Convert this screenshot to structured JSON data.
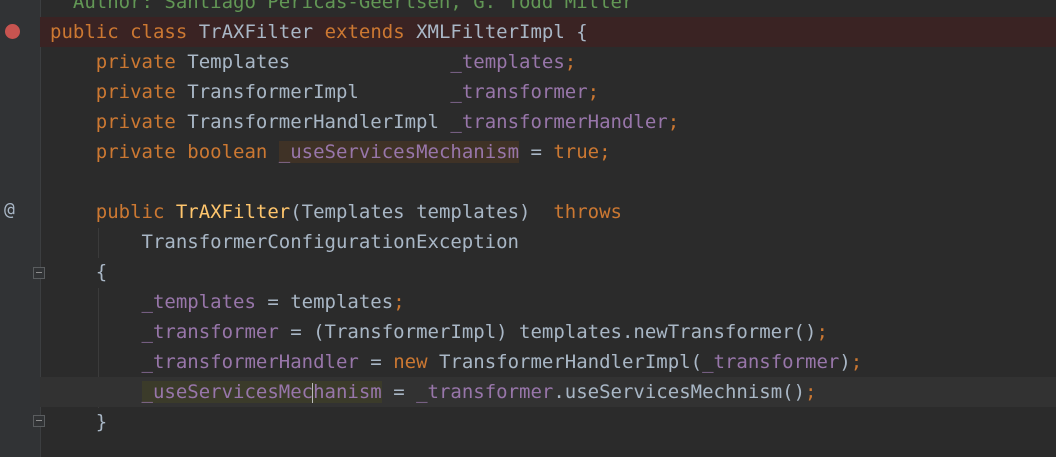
{
  "editor": {
    "lines": [
      {
        "tokens": [
          {
            "t": "  Author: Santiago Pericas-Geertsen, G. Todd Miller",
            "c": "cmt"
          }
        ]
      },
      {
        "tokens": [
          {
            "t": "public ",
            "c": "kw"
          },
          {
            "t": "class ",
            "c": "kw"
          },
          {
            "t": "TrAXFilter ",
            "c": "plain"
          },
          {
            "t": "extends ",
            "c": "kw"
          },
          {
            "t": "XMLFilterImpl {",
            "c": "plain"
          }
        ]
      },
      {
        "tokens": [
          {
            "t": "    private ",
            "c": "kw"
          },
          {
            "t": "Templates              ",
            "c": "plain"
          },
          {
            "t": "_templates",
            "c": "fld"
          },
          {
            "t": ";",
            "c": "kw"
          }
        ]
      },
      {
        "tokens": [
          {
            "t": "    private ",
            "c": "kw"
          },
          {
            "t": "TransformerImpl        ",
            "c": "plain"
          },
          {
            "t": "_transformer",
            "c": "fld"
          },
          {
            "t": ";",
            "c": "kw"
          }
        ]
      },
      {
        "tokens": [
          {
            "t": "    private ",
            "c": "kw"
          },
          {
            "t": "TransformerHandlerImpl ",
            "c": "plain"
          },
          {
            "t": "_transformerHandler",
            "c": "fld"
          },
          {
            "t": ";",
            "c": "kw"
          }
        ]
      },
      {
        "tokens": [
          {
            "t": "    private ",
            "c": "kw"
          },
          {
            "t": "boolean ",
            "c": "kw"
          },
          {
            "t": "_useServicesMechanism",
            "c": "fld hl-field"
          },
          {
            "t": " = ",
            "c": "plain"
          },
          {
            "t": "true",
            "c": "kw"
          },
          {
            "t": ";",
            "c": "kw"
          }
        ]
      },
      {
        "tokens": []
      },
      {
        "tokens": [
          {
            "t": "    public ",
            "c": "kw"
          },
          {
            "t": "TrAXFilter",
            "c": "mth"
          },
          {
            "t": "(Templates templates)  ",
            "c": "plain"
          },
          {
            "t": "throws",
            "c": "kw"
          }
        ]
      },
      {
        "tokens": [
          {
            "t": "        TransformerConfigurationException",
            "c": "plain"
          }
        ]
      },
      {
        "tokens": [
          {
            "t": "    {",
            "c": "plain"
          }
        ]
      },
      {
        "tokens": [
          {
            "t": "        ",
            "c": "plain"
          },
          {
            "t": "_templates",
            "c": "fld"
          },
          {
            "t": " = templates",
            "c": "plain"
          },
          {
            "t": ";",
            "c": "kw"
          }
        ]
      },
      {
        "tokens": [
          {
            "t": "        ",
            "c": "plain"
          },
          {
            "t": "_transformer",
            "c": "fld"
          },
          {
            "t": " = (TransformerImpl) templates.newTransformer()",
            "c": "plain"
          },
          {
            "t": ";",
            "c": "kw"
          }
        ]
      },
      {
        "tokens": [
          {
            "t": "        ",
            "c": "plain"
          },
          {
            "t": "_transformerHandler",
            "c": "fld"
          },
          {
            "t": " = ",
            "c": "plain"
          },
          {
            "t": "new ",
            "c": "kw"
          },
          {
            "t": "TransformerHandlerImpl(",
            "c": "plain"
          },
          {
            "t": "_transformer",
            "c": "fld"
          },
          {
            "t": ")",
            "c": "plain"
          },
          {
            "t": ";",
            "c": "kw"
          }
        ]
      },
      {
        "tokens": [
          {
            "t": "        ",
            "c": "plain"
          },
          {
            "t": "_useServicesMec",
            "c": "fld hl-field2"
          },
          {
            "t": "|",
            "c": "caret"
          },
          {
            "t": "hanism",
            "c": "fld hl-field2"
          },
          {
            "t": " = ",
            "c": "plain"
          },
          {
            "t": "_transformer",
            "c": "fld"
          },
          {
            "t": ".useServicesMechnism()",
            "c": "plain"
          },
          {
            "t": ";",
            "c": "kw"
          }
        ]
      },
      {
        "tokens": [
          {
            "t": "    }",
            "c": "plain"
          }
        ]
      }
    ],
    "gutter": {
      "breakpoint_icon": "breakpoint-icon",
      "override_marker": "@"
    }
  }
}
